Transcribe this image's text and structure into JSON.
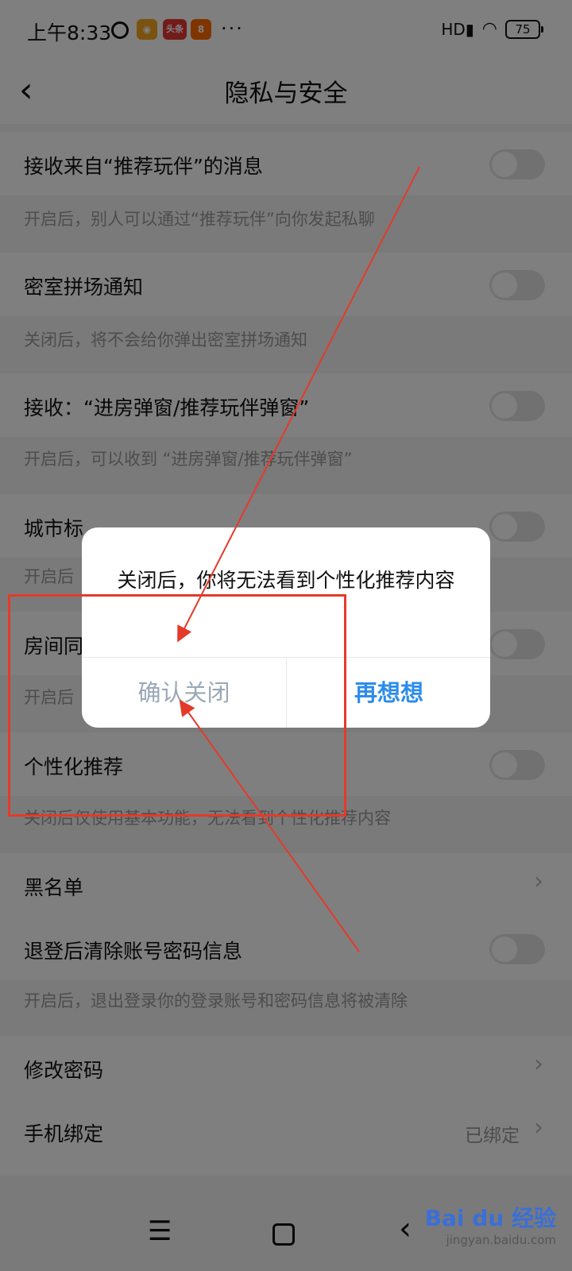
{
  "status_bar": {
    "time": "上午8:33",
    "toutiao_label": "头条",
    "more": "···",
    "signal": "HD",
    "battery": "75",
    "icons": [
      "alarm-icon",
      "weibo-icon",
      "toutiao-icon",
      "app-icon",
      "signal-icon",
      "wifi-icon",
      "battery-icon"
    ]
  },
  "navbar": {
    "back_icon": "‹",
    "title": "隐私与安全"
  },
  "settings": {
    "recommend_msg": {
      "label": "接收来自“推荐玩伴”的消息",
      "desc": "开启后，别人可以通过“推荐玩伴”向你发起私聊",
      "enabled": false
    },
    "escape_room": {
      "label": "密室拼场通知",
      "desc": "关闭后，将不会给你弹出密室拼场通知",
      "enabled": false
    },
    "popup": {
      "label": "接收：“进房弹窗/推荐玩伴弹窗”",
      "desc": "开启后，可以收到 “进房弹窗/推荐玩伴弹窗”",
      "enabled": false
    },
    "city_tag": {
      "label": "城市标",
      "desc": "开启后",
      "enabled": false
    },
    "room_same": {
      "label": "房间同",
      "desc": "开启后",
      "enabled": false
    },
    "personal": {
      "label": "个性化推荐",
      "desc": "关闭后仅使用基本功能，无法看到个性化推荐内容",
      "enabled": false
    },
    "blacklist": {
      "label": "黑名单"
    },
    "logout_clear": {
      "label": "退登后清除账号密码信息",
      "desc": "开启后，退出登录你的登录账号和密码信息将被清除",
      "enabled": false
    },
    "change_pwd": {
      "label": "修改密码"
    },
    "phone_bind": {
      "label": "手机绑定",
      "value": "已绑定"
    }
  },
  "dialog": {
    "message": "关闭后，你将无法看到个性化推荐内容",
    "confirm_label": "确认关闭",
    "cancel_label": "再想想"
  },
  "watermark": {
    "logo": "Bai du 经验",
    "sub": "jingyan.baidu.com"
  },
  "colors": {
    "accent": "#2d8ceb",
    "annotation": "#e43a2a",
    "confirm_text": "#9aa8b6"
  }
}
